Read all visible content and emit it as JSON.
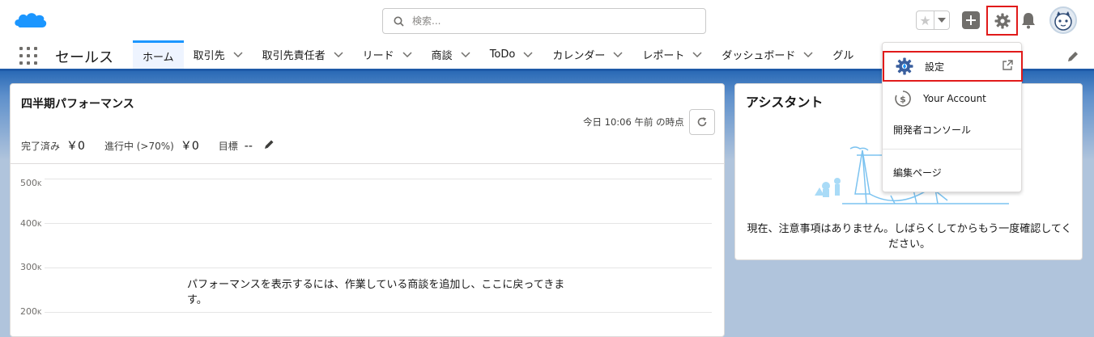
{
  "header": {
    "search_placeholder": "検索...",
    "favorites_star": "★"
  },
  "nav": {
    "app_name": "セールス",
    "tabs": [
      {
        "label": "ホーム",
        "active": true,
        "has_menu": false
      },
      {
        "label": "取引先",
        "active": false,
        "has_menu": true
      },
      {
        "label": "取引先責任者",
        "active": false,
        "has_menu": true
      },
      {
        "label": "リード",
        "active": false,
        "has_menu": true
      },
      {
        "label": "商談",
        "active": false,
        "has_menu": true
      },
      {
        "label": "ToDo",
        "active": false,
        "has_menu": true
      },
      {
        "label": "カレンダー",
        "active": false,
        "has_menu": true
      },
      {
        "label": "レポート",
        "active": false,
        "has_menu": true
      },
      {
        "label": "ダッシュボード",
        "active": false,
        "has_menu": true
      },
      {
        "label": "グル",
        "active": false,
        "has_menu": false
      }
    ]
  },
  "performance": {
    "title": "四半期パフォーマンス",
    "as_of": "今日 10:06 午前 の時点",
    "stats": {
      "closed_label": "完了済み",
      "closed_value": "￥0",
      "open_label": "進行中 (>70%)",
      "open_value": "￥0",
      "goal_label": "目標",
      "goal_value": "--"
    },
    "y_ticks": [
      "500",
      "400",
      "300",
      "200"
    ],
    "y_tick_unit": "K",
    "empty_message": "パフォーマンスを表示するには、作業している商談を追加し、ここに戻ってきます。"
  },
  "assistant": {
    "title": "アシスタント",
    "message": "現在、注意事項はありません。しばらくしてからもう一度確認してください。"
  },
  "setup_menu": {
    "items": [
      {
        "label": "設定",
        "icon": "setup-gear-icon"
      },
      {
        "label": "Your Account",
        "icon": "dollar-circle-icon"
      },
      {
        "label": "開発者コンソール"
      },
      {
        "label": "編集ページ"
      }
    ]
  },
  "colors": {
    "brand_blue": "#1b96ff",
    "nav_underline": "#1e5aa8",
    "highlight_red": "#e11a1a",
    "background_blue": "#b0c4dc"
  }
}
